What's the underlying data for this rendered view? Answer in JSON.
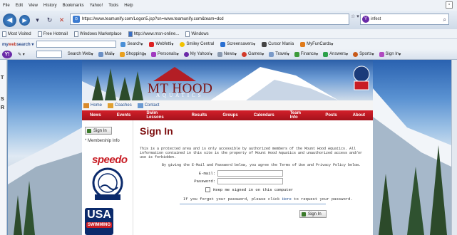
{
  "browser": {
    "menu": [
      "File",
      "Edit",
      "View",
      "History",
      "Bookmarks",
      "Yahoo!",
      "Tools",
      "Help"
    ],
    "url": "https://www.teamunify.com/Logon5.jsp?sn=www.teamunify.com&team=dcd",
    "search_value": "infest",
    "favorites": [
      "Most Visited",
      "Free Hotmail",
      "Windows Marketplace",
      "http://www.msn-online...",
      "Windows"
    ],
    "toolbar1": {
      "brand_prefix": "my",
      "brand_bold": "web",
      "brand_suffix": "search",
      "items": [
        "Search",
        "Webfetti",
        "Smiley Central",
        "Screensavers",
        "Cursor Mania",
        "MyFunCards"
      ]
    },
    "toolbar2": {
      "items": [
        "Search Web",
        "Mail",
        "Shopping",
        "Personals",
        "My Yahoo!",
        "News",
        "Games",
        "Travel",
        "Finance",
        "Answers",
        "Sports",
        "Sign In"
      ]
    }
  },
  "left_panel_letters": [
    "T",
    "S",
    "R"
  ],
  "site": {
    "logo_main": "MT HOOD",
    "logo_sub": "AQUATICS",
    "subnav": [
      "Home",
      "Coaches",
      "Contact"
    ],
    "mainnav": [
      "News",
      "Events",
      "Swim Lessons",
      "Results",
      "Groups",
      "Calendars",
      "Team Info",
      "Posts",
      "About"
    ],
    "sidebar": {
      "signin_label": "Sign In",
      "membership_label": "* Membership Info",
      "speedo": "speedo",
      "usa_top": "USA",
      "usa_band": "SWIMMING"
    },
    "page": {
      "title": "Sign In",
      "intro": "This is a protected area and is only accessible by authorized members of the Mount Hood Aquatics. All information contained in this site is the property of Mount Hood Aquatics and unauthorized access and/or use is forbidden.",
      "agree": "By giving the E-Mail and Password below, you agree the Terms of Use and Privacy Policy below.",
      "email_label": "E-mail:",
      "password_label": "Password:",
      "keep_signed_in": "Keep me signed in on this computer",
      "forgot_prefix": "If you forgot your password, please click",
      "forgot_link": "Here",
      "forgot_suffix": "to request your password.",
      "signin_button": "Sign In"
    }
  }
}
